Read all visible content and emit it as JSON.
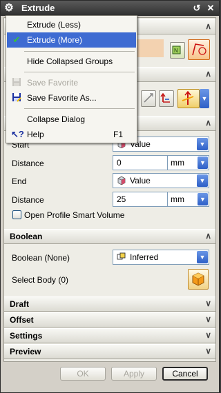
{
  "title": "Extrude",
  "menu": {
    "items": [
      {
        "label": "Extrude (Less)"
      },
      {
        "label": "Extrude (More)"
      },
      {
        "label": "Hide Collapsed Groups"
      },
      {
        "label": "Save Favorite"
      },
      {
        "label": "Save Favorite As..."
      },
      {
        "label": "Collapse Dialog"
      },
      {
        "label": "Help",
        "shortcut": "F1"
      }
    ]
  },
  "limits": {
    "start_label": "Start",
    "start_value": "Value",
    "start_distance_label": "Distance",
    "start_distance": "0",
    "start_unit": "mm",
    "end_label": "End",
    "end_value": "Value",
    "end_distance_label": "Distance",
    "end_distance": "25",
    "end_unit": "mm",
    "open_profile_label": "Open Profile Smart Volume"
  },
  "boolean": {
    "header": "Boolean",
    "label": "Boolean (None)",
    "value": "Inferred",
    "select_body_label": "Select Body (0)"
  },
  "sections": {
    "draft": "Draft",
    "offset": "Offset",
    "settings": "Settings",
    "preview": "Preview"
  },
  "buttons": {
    "ok": "OK",
    "apply": "Apply",
    "cancel": "Cancel"
  }
}
